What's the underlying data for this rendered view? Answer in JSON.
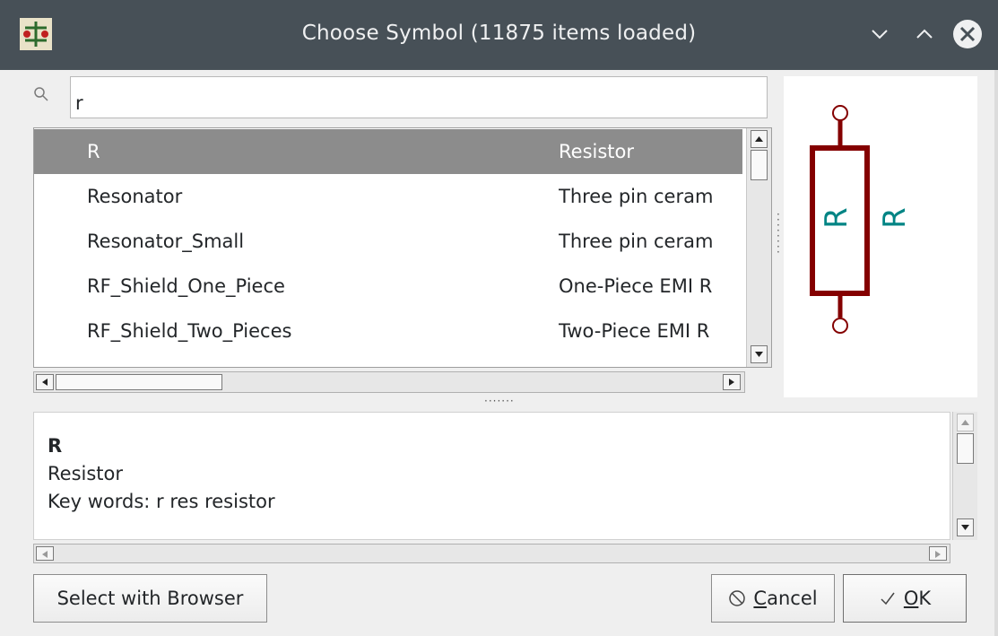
{
  "window": {
    "title": "Choose Symbol (11875 items loaded)",
    "controls": [
      "minimize-icon",
      "maximize-icon",
      "close-icon"
    ]
  },
  "search": {
    "value": "r",
    "icon": "search-icon"
  },
  "tree": {
    "rows": [
      {
        "name": "R",
        "description": "Resistor",
        "selected": true
      },
      {
        "name": "Resonator",
        "description": "Three pin ceram"
      },
      {
        "name": "Resonator_Small",
        "description": "Three pin ceram"
      },
      {
        "name": "RF_Shield_One_Piece",
        "description": "One-Piece EMI R"
      },
      {
        "name": "RF_Shield_Two_Pieces",
        "description": "Two-Piece EMI R"
      }
    ]
  },
  "preview": {
    "reference": "R",
    "value": "R",
    "body_color": "#840000",
    "text_color": "#008484"
  },
  "details": {
    "name": "R",
    "description": "Resistor",
    "keywords": "Key words: r res resistor"
  },
  "buttons": {
    "browser": "Select with Browser",
    "cancel_prefix": "",
    "cancel_mnemonic": "C",
    "cancel_rest": "ancel",
    "ok_mnemonic": "O",
    "ok_rest": "K"
  },
  "colors": {
    "titlebar": "#475057",
    "selection": "#8c8c8c"
  }
}
